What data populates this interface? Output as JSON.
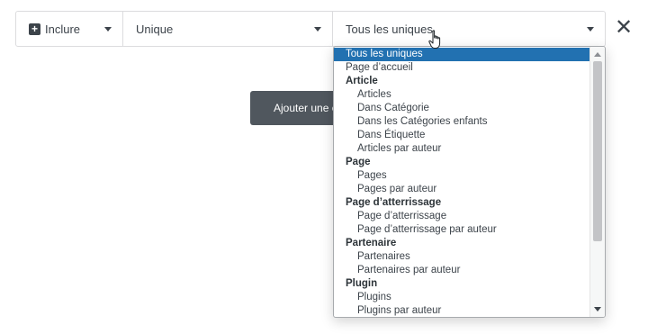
{
  "condition": {
    "type_label": "Inclure",
    "rule_label": "Unique",
    "sub_rule_label": "Tous les uniques"
  },
  "add_button_label": "Ajouter une c",
  "dropdown": {
    "items": [
      {
        "label": "Tous les uniques",
        "kind": "top",
        "selected": true
      },
      {
        "label": "Page d’accueil",
        "kind": "top"
      },
      {
        "label": "Article",
        "kind": "group"
      },
      {
        "label": "Articles",
        "kind": "child"
      },
      {
        "label": "Dans Catégorie",
        "kind": "child"
      },
      {
        "label": "Dans les Catégories enfants",
        "kind": "child"
      },
      {
        "label": "Dans Étiquette",
        "kind": "child"
      },
      {
        "label": "Articles par auteur",
        "kind": "child"
      },
      {
        "label": "Page",
        "kind": "group"
      },
      {
        "label": "Pages",
        "kind": "child"
      },
      {
        "label": "Pages par auteur",
        "kind": "child"
      },
      {
        "label": "Page d’atterrissage",
        "kind": "group"
      },
      {
        "label": "Page d’atterrissage",
        "kind": "child"
      },
      {
        "label": "Page d’atterrissage par auteur",
        "kind": "child"
      },
      {
        "label": "Partenaire",
        "kind": "group"
      },
      {
        "label": "Partenaires",
        "kind": "child"
      },
      {
        "label": "Partenaires par auteur",
        "kind": "child"
      },
      {
        "label": "Plugin",
        "kind": "group"
      },
      {
        "label": "Plugins",
        "kind": "child"
      },
      {
        "label": "Plugins par auteur",
        "kind": "child"
      }
    ]
  }
}
